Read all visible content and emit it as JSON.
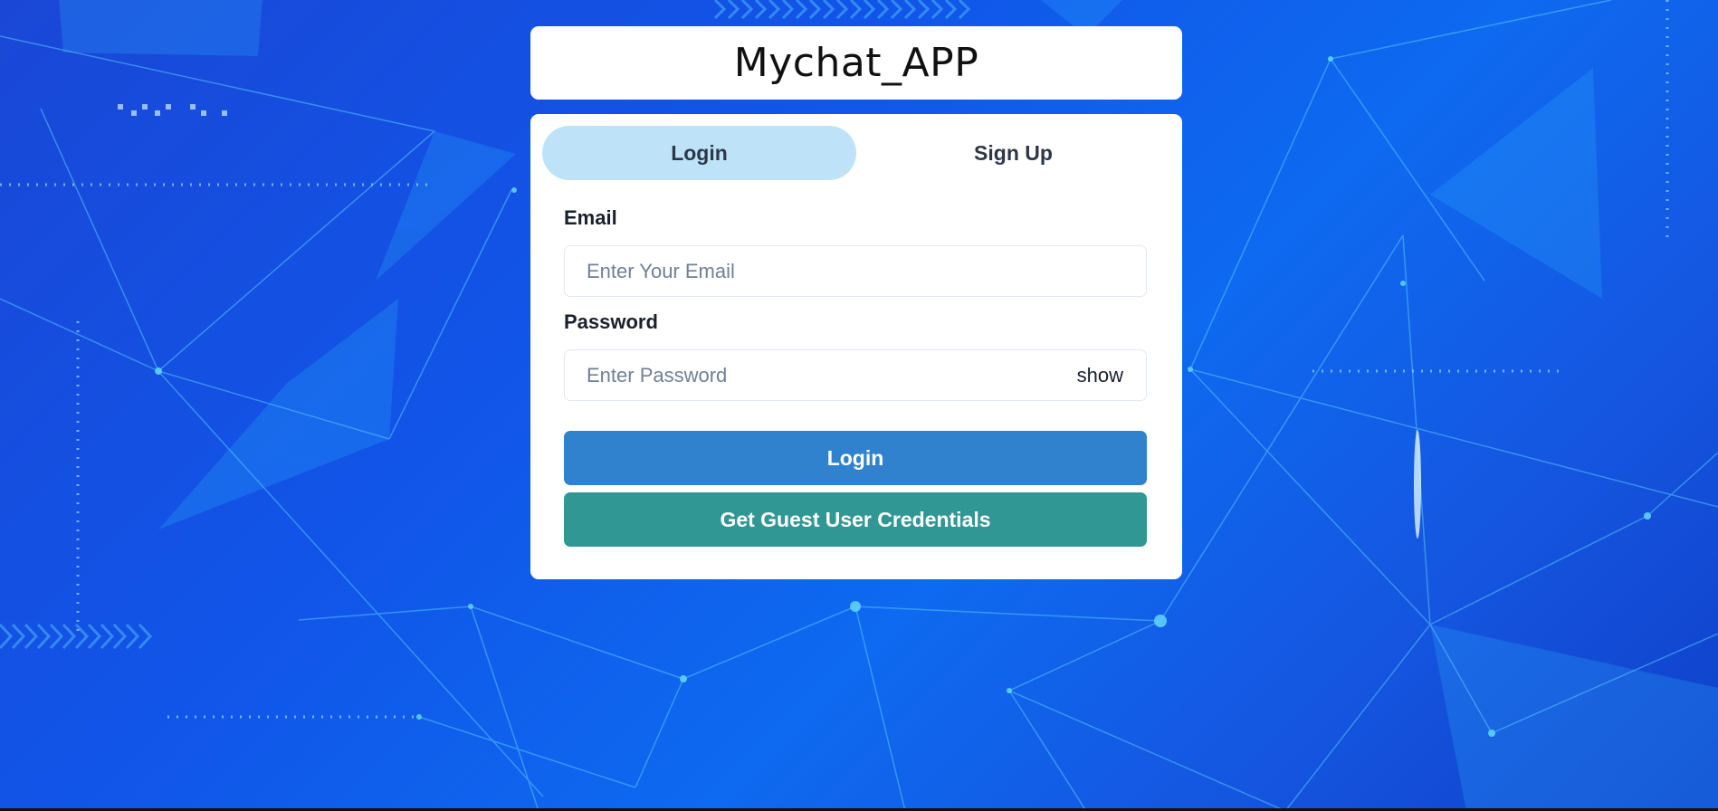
{
  "app": {
    "title": "Mychat_APP"
  },
  "tabs": [
    {
      "label": "Login",
      "active": true
    },
    {
      "label": "Sign Up",
      "active": false
    }
  ],
  "form": {
    "email_label": "Email",
    "email_placeholder": "Enter Your Email",
    "email_value": "",
    "password_label": "Password",
    "password_placeholder": "Enter Password",
    "password_value": "",
    "show_label": "show"
  },
  "buttons": {
    "login_label": "Login",
    "guest_label": "Get Guest User Credentials"
  },
  "colors": {
    "active_tab": "#bee3f8",
    "login_button": "#3182ce",
    "guest_button": "#319795",
    "background": "#1155e8"
  }
}
